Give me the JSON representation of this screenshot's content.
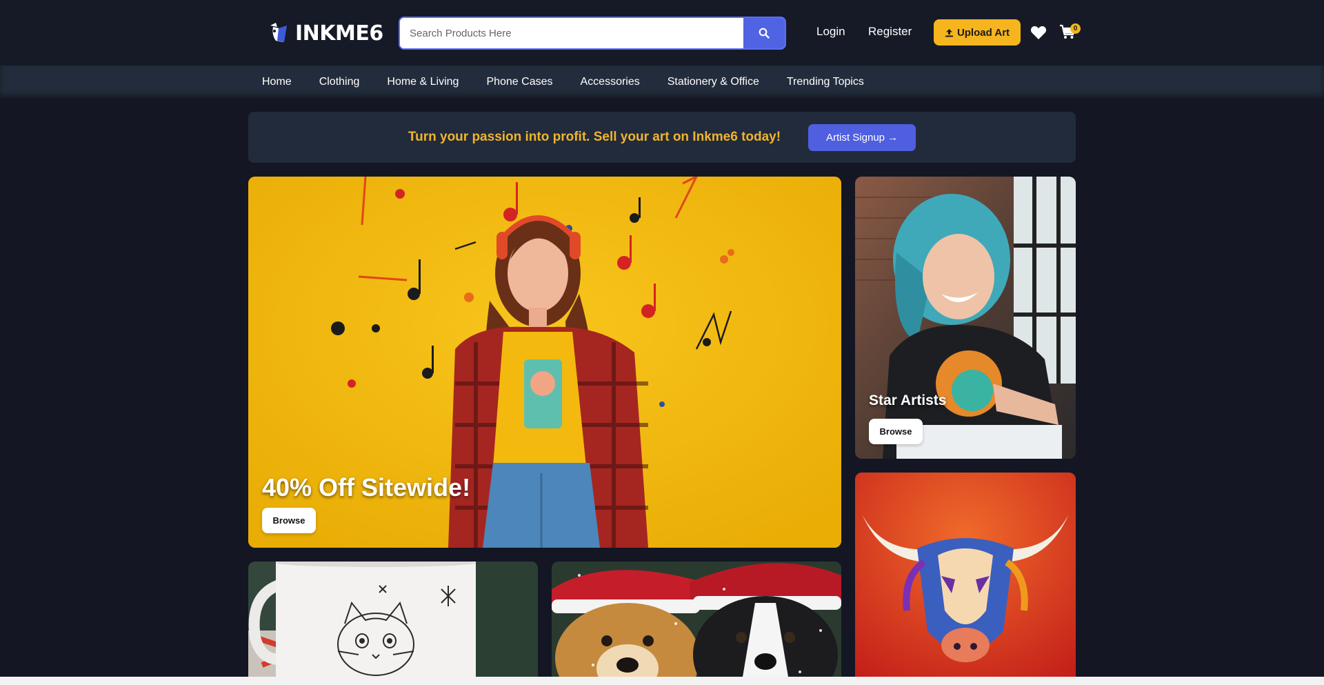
{
  "header": {
    "logo_text": "INKME6",
    "search_placeholder": "Search Products Here",
    "login_label": "Login",
    "register_label": "Register",
    "upload_label": "Upload Art",
    "cart_count": "0",
    "accent_color": "#4f63e3",
    "highlight_color": "#f6b51e"
  },
  "nav": {
    "items": [
      "Home",
      "Clothing",
      "Home & Living",
      "Phone Cases",
      "Accessories",
      "Stationery & Office",
      "Trending Topics"
    ]
  },
  "promo": {
    "text": "Turn your passion into profit. Sell your art on Inkme6 today!",
    "button_label": "Artist Signup →"
  },
  "tiles": {
    "hero": {
      "title": "40% Off Sitewide!",
      "button_label": "Browse"
    },
    "star_artists": {
      "title": "Star Artists",
      "button_label": "Browse"
    }
  },
  "icons": [
    "logo-icon",
    "search-icon",
    "upload-icon",
    "heart-icon",
    "cart-icon"
  ]
}
